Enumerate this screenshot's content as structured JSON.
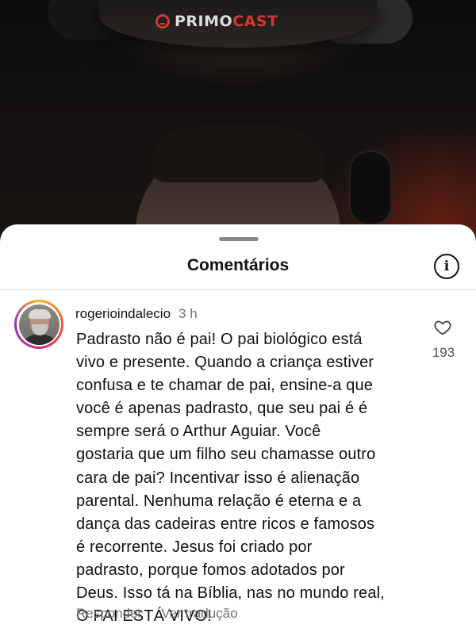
{
  "video": {
    "logo_prefix": "PRIMO",
    "logo_suffix": "CAST"
  },
  "sheet": {
    "title": "Comentários",
    "info_icon": "info-icon"
  },
  "comment": {
    "username": "rogerioindalecio",
    "time": "3 h",
    "lines": [
      "Padrasto não é pai! O pai biológico está",
      "vivo e presente. Quando a criança estiver",
      "confusa e te chamar de pai, ensine-a que",
      "você é apenas padrasto, que seu pai é é",
      "sempre será o Arthur Aguiar. Você",
      "gostaria que um filho seu chamasse outro",
      "cara de pai? Incentivar isso é alienação",
      "parental. Nenhuma relação é eterna e a",
      "dança das cadeiras entre ricos e famosos",
      "é recorrente. Jesus foi criado por",
      "padrasto, porque fomos adotados por",
      "Deus. Isso tá na Bíblia, nas no mundo real,",
      "O PAI ESTÁ VIVO!"
    ],
    "like_icon": "heart-icon",
    "like_count": "193",
    "reply_label": "Responder",
    "translate_label": "Ver tradução"
  }
}
